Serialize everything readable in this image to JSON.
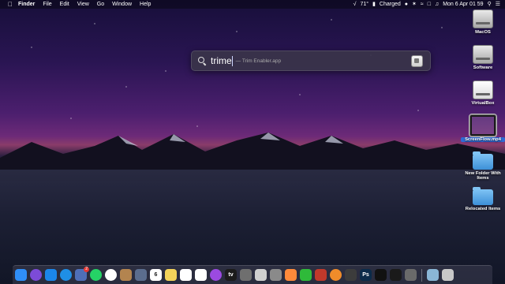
{
  "menubar": {
    "apple_icon": "apple-logo-icon",
    "items": [
      "Finder",
      "File",
      "Edit",
      "View",
      "Go",
      "Window",
      "Help"
    ],
    "status": {
      "temperature": "71°",
      "battery_text": "Charged",
      "datetime": "Mon 6 Apr  01 59"
    }
  },
  "spotlight": {
    "query": "trime",
    "suggestion": "— Trim Enabler.app",
    "icon": "search-icon"
  },
  "desktop": {
    "icons": [
      {
        "label": "MacOS",
        "icon": "hard-drive-icon"
      },
      {
        "label": "Software",
        "icon": "hard-drive-icon"
      },
      {
        "label": "VirtualBox",
        "icon": "external-drive-icon"
      },
      {
        "label": "ScreenFlow.mp4",
        "icon": "video-file-icon",
        "selected": true
      },
      {
        "label": "New Folder With Items",
        "icon": "folder-icon"
      },
      {
        "label": "Relocated Items",
        "icon": "folder-icon"
      }
    ]
  },
  "dock": {
    "items": [
      {
        "name": "Finder",
        "color": "#2f8ef7"
      },
      {
        "name": "Siri",
        "color": "#7c4bd8"
      },
      {
        "name": "App Store",
        "color": "#1b86ea"
      },
      {
        "name": "Safari",
        "color": "#1f8fe6"
      },
      {
        "name": "Mail",
        "color": "#4f6fb8",
        "badge": "2"
      },
      {
        "name": "WhatsApp",
        "color": "#25d366"
      },
      {
        "name": "Messages",
        "color": "#ffffff"
      },
      {
        "name": "Notes Book",
        "color": "#b3844f"
      },
      {
        "name": "Launchpad",
        "color": "#5b6d8e"
      },
      {
        "name": "Calendar",
        "color": "#ffffff",
        "date": "6"
      },
      {
        "name": "Notes",
        "color": "#f3d35a"
      },
      {
        "name": "Reminders",
        "color": "#ffffff"
      },
      {
        "name": "Photos",
        "color": "#ffffff"
      },
      {
        "name": "Podcasts",
        "color": "#9b4ae0"
      },
      {
        "name": "Apple TV",
        "color": "#1b1b1b",
        "label": "tv"
      },
      {
        "name": "Automator",
        "color": "#6f6f6f"
      },
      {
        "name": "Preview",
        "color": "#cfcfcf"
      },
      {
        "name": "System Preferences",
        "color": "#8a8a8a"
      },
      {
        "name": "Maps",
        "color": "#ff8a3a"
      },
      {
        "name": "FaceTime",
        "color": "#2fba3a"
      },
      {
        "name": "Photo Booth",
        "color": "#c0392b"
      },
      {
        "name": "Books",
        "color": "#f08c2a"
      },
      {
        "name": "Final Cut Pro",
        "color": "#3c3c3c"
      },
      {
        "name": "Photoshop",
        "color": "#0b2b4a",
        "label": "Ps"
      },
      {
        "name": "Activity Monitor",
        "color": "#111111"
      },
      {
        "name": "Terminal",
        "color": "#1a1a1a"
      },
      {
        "name": "Screenshot",
        "color": "#6a6a6a"
      },
      {
        "name": "Downloads",
        "color": "#8ab6d6"
      },
      {
        "name": "Trash",
        "color": "#c8c8c8"
      }
    ]
  },
  "colors": {
    "accent": "#2f6bd6",
    "menubar_bg": "#0a0814"
  }
}
